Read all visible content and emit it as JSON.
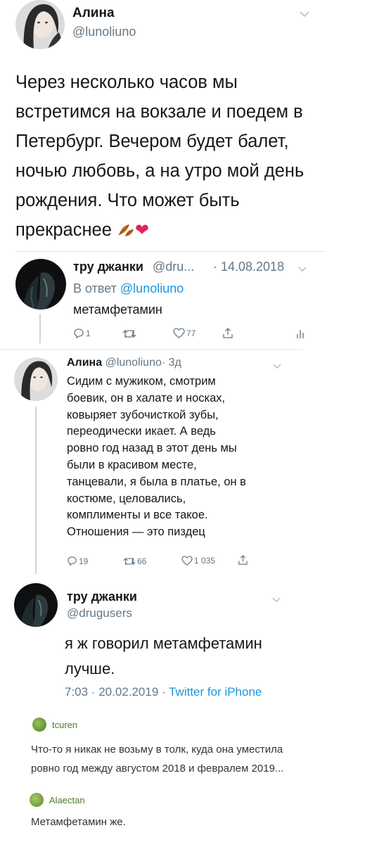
{
  "tweet1": {
    "author_name": "Алина",
    "author_handle": "@lunoliuno",
    "text": "Через несколько часов мы встретимся на вокзале и поедем в Петербург. Вечером будет балет, ночью любовь, а на утро мой день рождения. Что может быть прекраснее",
    "emoji": [
      "fallen-leaf-icon",
      "red-heart-icon"
    ]
  },
  "reply1": {
    "author_name": "тру джанки",
    "author_handle": "@dru...",
    "date": "· 14.08.2018",
    "reply_prefix": "В ответ",
    "reply_to": "@lunoliuno",
    "text": "метамфетамин",
    "reply_count": "1",
    "like_count": "77"
  },
  "reply2": {
    "author_name": "Алина",
    "author_handle": "@lunoliuno",
    "time": "· 3д",
    "lines": [
      "Сидим с мужиком, смотрим",
      "боевик, он в халате и носках,",
      "ковыряет зубочисткой зубы,",
      "переодически икает. А ведь",
      "ровно год назад в этот день мы",
      "были в красивом месте,",
      "танцевали, я была в платье, он в",
      "костюме, целовались,",
      "комплименты и все такое.",
      "Отношения — это пиздец"
    ],
    "reply_count": "19",
    "retweet_count": "66",
    "like_count": "1 035"
  },
  "tweet4": {
    "author_name": "тру джанки",
    "author_handle": "@drugusers",
    "line1": "я ж говорил метамфетамин",
    "line2": "лучше.",
    "meta_time": "7:03 · 20.02.2019 ·",
    "meta_source": "Twitter for iPhone"
  },
  "comments": [
    {
      "user": "tcuren",
      "line1": "Что-то я никак не возьму в толк, куда она уместила",
      "line2": "ровно год между августом 2018 и февралем 2019..."
    },
    {
      "user": "Alaectan",
      "line1": "Метамфетамин же."
    }
  ],
  "colors": {
    "link": "#1b95e0",
    "secondary": "#657786",
    "heart": "#e0245e",
    "comment_user": "#4a7a2a"
  }
}
